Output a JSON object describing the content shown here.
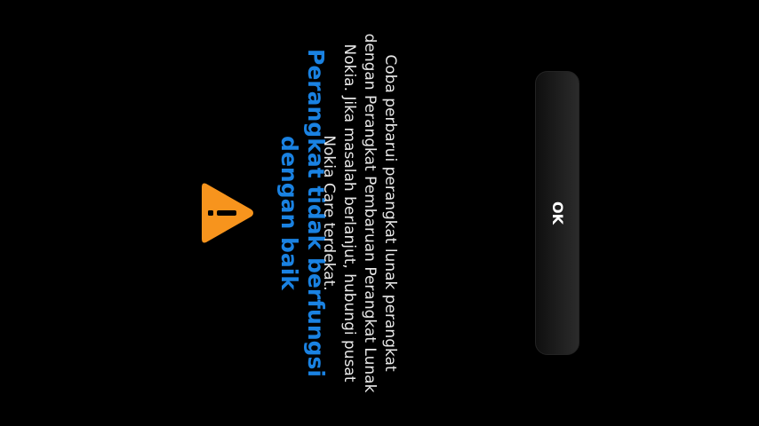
{
  "dialog": {
    "icon": "warning-triangle-icon",
    "icon_color": "#f7941d",
    "title": "Perangkat tidak berfungsi dengan baik",
    "title_color": "#1a82e2",
    "message": "Coba perbarui perangkat lunak perangkat dengan Perangkat Pembaruan Perangkat Lunak Nokia. Jika masalah berlanjut, hubungi pusat Nokia Care terdekat.",
    "ok_label": "OK"
  }
}
